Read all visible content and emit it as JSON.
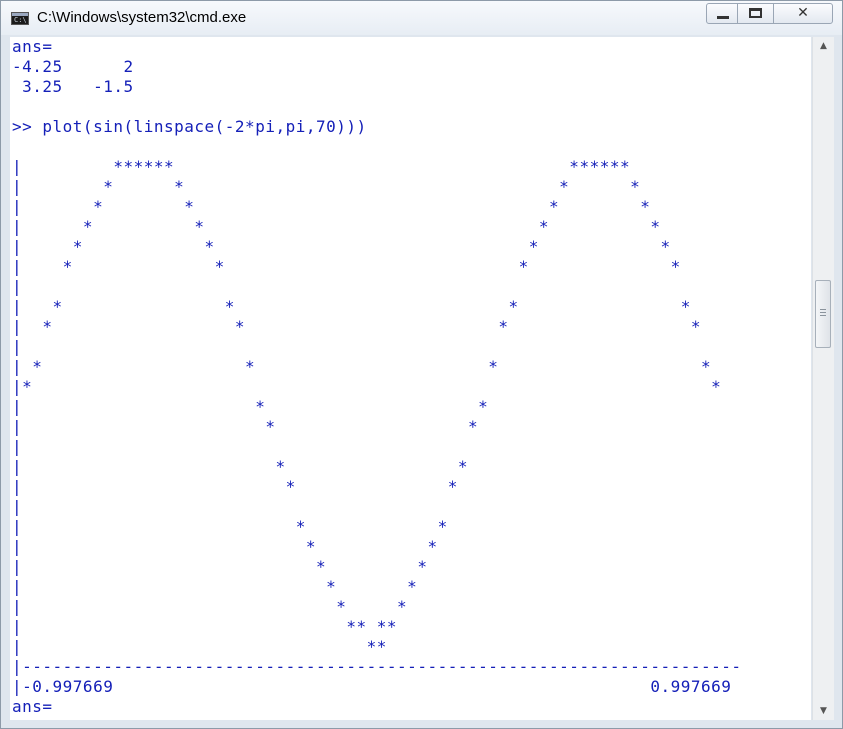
{
  "window": {
    "title": "C:\\Windows\\system32\\cmd.exe",
    "icon": "cmd-icon",
    "icon_text": "C:\\",
    "controls": {
      "minimize": "minimize-icon",
      "maximize": "maximize-icon",
      "close": "✕"
    }
  },
  "colors": {
    "console_text": "#1520b8",
    "console_bg": "#ffffff"
  },
  "console": {
    "lines": [
      "ans=",
      "-4.25      2",
      " 3.25   -1.5",
      "",
      ">> plot(sin(linspace(-2*pi,pi,70)))",
      "",
      "|         ******                                       ******",
      "|        *      *                                     *      *",
      "|       *        *                                   *        *",
      "|      *          *                                 *          *",
      "|     *            *                               *            *",
      "|    *              *                             *              *",
      "|",
      "|   *                *                           *                *",
      "|  *                  *                         *                  *",
      "|",
      "| *                    *                       *                    *",
      "|*                                                                   *",
      "|                       *                     *",
      "|                        *                   *",
      "|",
      "|                         *                 *",
      "|                          *               *",
      "|",
      "|                           *             *",
      "|                            *           *",
      "|                             *         *",
      "|                              *       *",
      "|                               *     *",
      "|                                ** **",
      "|                                  **",
      "|-----------------------------------------------------------------------",
      "|-0.997669                                                     0.997669",
      "ans="
    ]
  },
  "scrollbar": {
    "up": "▲",
    "down": "▼"
  }
}
